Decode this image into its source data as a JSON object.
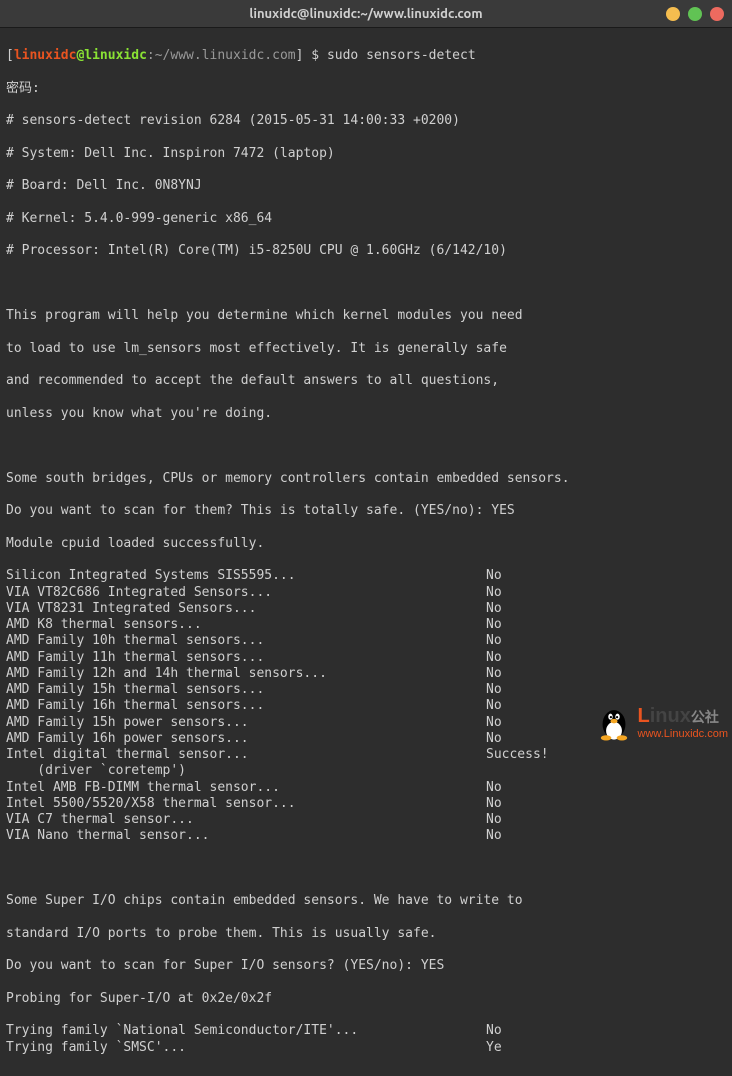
{
  "titlebar": {
    "title": "linuxidc@linuxidc:~/www.linuxidc.com"
  },
  "prompt": {
    "user": "linuxidc",
    "at": "@",
    "host": "linuxidc",
    "sep": ":",
    "path": "~/www.linuxidc.com",
    "end": "] $ ",
    "command": "sudo sensors-detect"
  },
  "lines": {
    "pwd": "密码:",
    "rev": "# sensors-detect revision 6284 (2015-05-31 14:00:33 +0200)",
    "sys": "# System: Dell Inc. Inspiron 7472 (laptop)",
    "board": "# Board: Dell Inc. 0N8YNJ",
    "kernel": "# Kernel: 5.4.0-999-generic x86_64",
    "cpu": "# Processor: Intel(R) Core(TM) i5-8250U CPU @ 1.60GHz (6/142/10)",
    "intro1": "This program will help you determine which kernel modules you need",
    "intro2": "to load to use lm_sensors most effectively. It is generally safe",
    "intro3": "and recommended to accept the default answers to all questions,",
    "intro4": "unless you know what you're doing.",
    "south1": "Some south bridges, CPUs or memory controllers contain embedded sensors.",
    "south2": "Do you want to scan for them? This is totally safe. (YES/no): YES",
    "cpuid": "Module cpuid loaded successfully.",
    "driver": "    (driver `coretemp')",
    "super1": "Some Super I/O chips contain embedded sensors. We have to write to",
    "super2": "standard I/O ports to probe them. This is usually safe.",
    "super3": "Do you want to scan for Super I/O sensors? (YES/no): YES",
    "probe": "Probing for Super-I/O at 0x2e/0x2f"
  },
  "sensors": [
    {
      "name": "Silicon Integrated Systems SIS5595...",
      "result": "No"
    },
    {
      "name": "VIA VT82C686 Integrated Sensors...",
      "result": "No"
    },
    {
      "name": "VIA VT8231 Integrated Sensors...",
      "result": "No"
    },
    {
      "name": "AMD K8 thermal sensors...",
      "result": "No"
    },
    {
      "name": "AMD Family 10h thermal sensors...",
      "result": "No"
    },
    {
      "name": "AMD Family 11h thermal sensors...",
      "result": "No"
    },
    {
      "name": "AMD Family 12h and 14h thermal sensors...",
      "result": "No"
    },
    {
      "name": "AMD Family 15h thermal sensors...",
      "result": "No"
    },
    {
      "name": "AMD Family 16h thermal sensors...",
      "result": "No"
    },
    {
      "name": "AMD Family 15h power sensors...",
      "result": "No"
    },
    {
      "name": "AMD Family 16h power sensors...",
      "result": "No"
    },
    {
      "name": "Intel digital thermal sensor...",
      "result": "Success!"
    },
    {
      "name": "Intel AMB FB-DIMM thermal sensor...",
      "result": "No"
    },
    {
      "name": "Intel 5500/5520/X58 thermal sensor...",
      "result": "No"
    },
    {
      "name": "VIA C7 thermal sensor...",
      "result": "No"
    },
    {
      "name": "VIA Nano thermal sensor...",
      "result": "No"
    }
  ],
  "trying": [
    {
      "name": "Trying family `National Semiconductor/ITE'...",
      "result": "No"
    },
    {
      "name": "Trying family `SMSC'...",
      "result": "Ye"
    }
  ],
  "watermark": {
    "brand_l": "L",
    "brand_rest": "inux",
    "brand_suffix": "公社",
    "url": "www.Linuxidc.com"
  }
}
